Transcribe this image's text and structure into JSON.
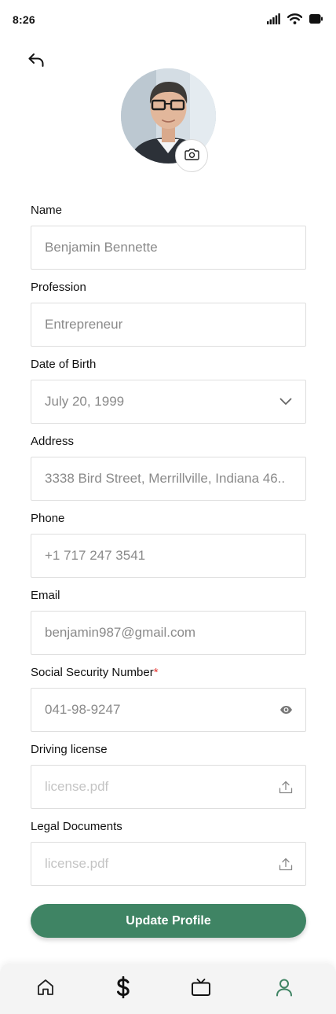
{
  "status_bar": {
    "time": "8:26",
    "icons": [
      "cellular-signal-icon",
      "wifi-icon",
      "battery-icon"
    ]
  },
  "header": {
    "back_icon": "back-arrow-icon"
  },
  "avatar": {
    "camera_icon": "camera-icon"
  },
  "form": {
    "name": {
      "label": "Name",
      "value": "Benjamin Bennette"
    },
    "profession": {
      "label": "Profession",
      "value": "Entrepreneur"
    },
    "date_of_birth": {
      "label": "Date of Birth",
      "value": "July 20, 1999",
      "icon": "chevron-down-icon"
    },
    "address": {
      "label": "Address",
      "value": "3338 Bird Street, Merrillville, Indiana 46.."
    },
    "phone": {
      "label": "Phone",
      "value": "+1 717 247 3541"
    },
    "email": {
      "label": "Email",
      "value": "benjamin987@gmail.com"
    },
    "ssn": {
      "label": "Social Security Number",
      "required_mark": "*",
      "value": "041-98-9247",
      "icon": "eye-icon"
    },
    "driving_license": {
      "label": "Driving license",
      "placeholder": "license.pdf",
      "icon": "upload-icon"
    },
    "legal_documents": {
      "label": "Legal Documents",
      "placeholder": "license.pdf",
      "icon": "upload-icon"
    }
  },
  "actions": {
    "update_label": "Update Profile"
  },
  "bottom_nav": {
    "items": [
      "home-icon",
      "dollar-icon",
      "tv-icon",
      "profile-icon"
    ],
    "active": "profile-icon"
  },
  "colors": {
    "accent": "#3f8464",
    "required": "#e53935",
    "field_border": "#dedede",
    "value_text": "#8a8a8a",
    "placeholder_text": "#c4c4c4"
  }
}
